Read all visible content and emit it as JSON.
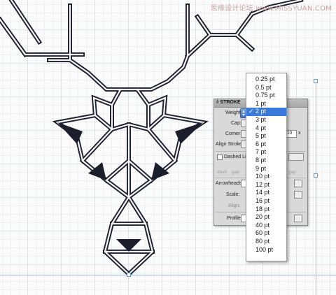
{
  "watermark": "思缘设计论坛 www.MISSYUAN.COM",
  "panel": {
    "title": "◊ STROKE",
    "weight_label": "Weight:",
    "cap_label": "Cap:",
    "corner_label": "Corner:",
    "corner_value": "10",
    "corner_unit": "x",
    "align_label": "Align Stroke:",
    "dashed_label": "Dashed Line",
    "dash_labels": [
      "dash",
      "gap",
      "gap"
    ],
    "arrowheads_label": "Arrowheads:",
    "scale_label": "Scale:",
    "align2_label": "Align:",
    "profile_label": "Profile:"
  },
  "weight_menu": {
    "selected": "2 pt",
    "check": "✓",
    "options": [
      "0.25 pt",
      "0.5 pt",
      "0.75 pt",
      "1 pt",
      "2 pt",
      "3 pt",
      "4 pt",
      "5 pt",
      "6 pt",
      "7 pt",
      "8 pt",
      "9 pt",
      "10 pt",
      "12 pt",
      "14 pt",
      "16 pt",
      "18 pt",
      "20 pt",
      "40 pt",
      "60 pt",
      "80 pt",
      "100 pt"
    ]
  },
  "colors": {
    "stroke_dark": "#1b1f2c",
    "stroke_inner": "#f7f7f9",
    "selection_blue": "#3879d9",
    "guide_blue": "#8fb3e2"
  }
}
